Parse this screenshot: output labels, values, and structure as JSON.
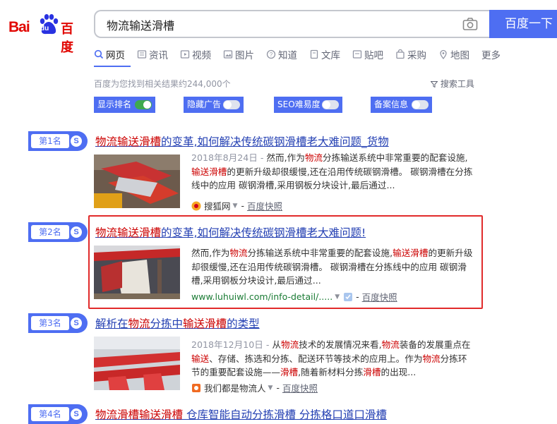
{
  "logo": {
    "bai": "Bai",
    "du": "du",
    "cn": "百度"
  },
  "search": {
    "query": "物流输送滑槽",
    "button": "百度一下"
  },
  "tabs": [
    {
      "label": "网页",
      "icon": "search-icon"
    },
    {
      "label": "资讯",
      "icon": "news-icon"
    },
    {
      "label": "视频",
      "icon": "video-icon"
    },
    {
      "label": "图片",
      "icon": "image-icon"
    },
    {
      "label": "知道",
      "icon": "question-icon"
    },
    {
      "label": "文库",
      "icon": "document-icon"
    },
    {
      "label": "贴吧",
      "icon": "forum-icon"
    },
    {
      "label": "采购",
      "icon": "purchase-icon"
    },
    {
      "label": "地图",
      "icon": "map-icon"
    },
    {
      "label": "更多",
      "icon": ""
    }
  ],
  "result_count": "百度为您找到相关结果约244,000个",
  "search_tools": "搜索工具",
  "toggles": [
    {
      "label": "显示排名",
      "on": true
    },
    {
      "label": "隐藏广告",
      "on": false
    },
    {
      "label": "SEO难易度",
      "on": false
    },
    {
      "label": "备案信息",
      "on": false
    }
  ],
  "colors": {
    "accent": "#4e6ef2",
    "highlight": "#cc0000",
    "link": "#2440b3",
    "frame": "#e12b2b"
  },
  "results": [
    {
      "rank": "第1名",
      "title_parts": [
        {
          "t": "物流输送滑槽",
          "hl": true
        },
        {
          "t": "的变革,如何解决传统碳钢滑槽老大难问题_货物",
          "hl": false
        }
      ],
      "snippet_parts": [
        {
          "t": "2018年8月24日 - ",
          "date": true
        },
        {
          "t": "然而,作为"
        },
        {
          "t": "物流",
          "hl": true
        },
        {
          "t": "分拣输送系统中非常重要的配套设施,"
        },
        {
          "t": "输送滑槽",
          "hl": true
        },
        {
          "t": "的更新升级却很缓慢,还在沿用传统碳钢滑槽。 碳钢滑槽在分拣线中的应用 碳钢滑槽,采用钢板分块设计,最后通过..."
        }
      ],
      "source": "搜狐网",
      "source_green": false,
      "snapshot": "百度快照",
      "favicon": "sohu-icon"
    },
    {
      "rank": "第2名",
      "title_parts": [
        {
          "t": "物流输送滑槽",
          "hl": true
        },
        {
          "t": "的变革,如何解决传统碳钢滑槽老大难问题!",
          "hl": false
        }
      ],
      "snippet_parts": [
        {
          "t": "然而,作为"
        },
        {
          "t": "物流",
          "hl": true
        },
        {
          "t": "分拣输送系统中非常重要的配套设施,"
        },
        {
          "t": "输送滑槽",
          "hl": true
        },
        {
          "t": "的更新升级却很缓慢,还在沿用传统碳钢滑槽。 碳钢滑槽在分拣线中的应用 碳钢滑槽,采用钢板分块设计,最后通过..."
        }
      ],
      "source": "www.luhuiwl.com/info-detail/.....",
      "source_green": true,
      "snapshot": "百度快照",
      "favicon": "site-icon"
    },
    {
      "rank": "第3名",
      "title_parts": [
        {
          "t": "解析在",
          "hl": false
        },
        {
          "t": "物流",
          "hl": true
        },
        {
          "t": "分拣中",
          "hl": false
        },
        {
          "t": "输送滑槽",
          "hl": true
        },
        {
          "t": "的类型",
          "hl": false
        }
      ],
      "snippet_parts": [
        {
          "t": "2018年12月10日 - ",
          "date": true
        },
        {
          "t": "从"
        },
        {
          "t": "物流",
          "hl": true
        },
        {
          "t": "技术的发展情况来看,"
        },
        {
          "t": "物流",
          "hl": true
        },
        {
          "t": "装备的发展重点在"
        },
        {
          "t": "输送",
          "hl": true
        },
        {
          "t": "、存储、拣选和分拣、配送环节等技术的应用上。作为"
        },
        {
          "t": "物流",
          "hl": true
        },
        {
          "t": "分拣环节的重要配套设施——"
        },
        {
          "t": "滑槽",
          "hl": true
        },
        {
          "t": ",随着新材料分拣"
        },
        {
          "t": "滑槽",
          "hl": true
        },
        {
          "t": "的出现..."
        }
      ],
      "source": "我们都是物流人",
      "source_green": false,
      "snapshot": "百度快照",
      "favicon": "wuliu-icon"
    },
    {
      "rank": "第4名",
      "title_parts": [
        {
          "t": "物流滑槽输送滑槽",
          "hl": true
        },
        {
          "t": " 仓库智能自动分拣滑槽 分拣格口道口滑槽",
          "hl": false
        }
      ]
    }
  ]
}
